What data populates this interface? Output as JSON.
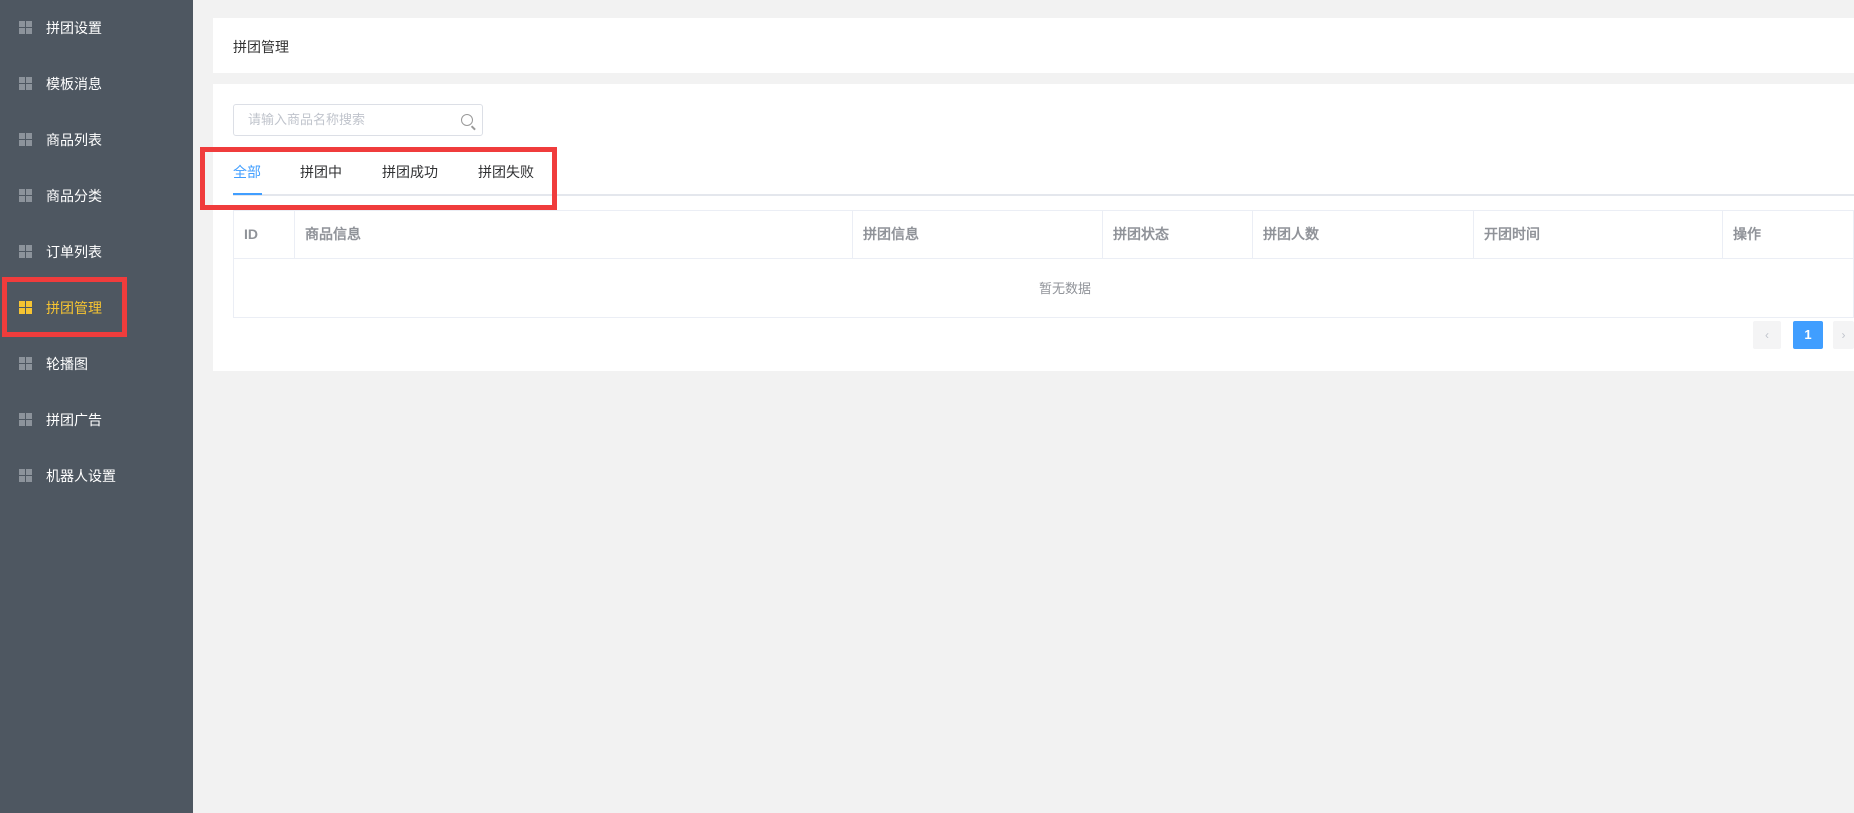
{
  "sidebar": {
    "items": [
      {
        "label": "拼团设置",
        "active": false
      },
      {
        "label": "模板消息",
        "active": false
      },
      {
        "label": "商品列表",
        "active": false
      },
      {
        "label": "商品分类",
        "active": false
      },
      {
        "label": "订单列表",
        "active": false
      },
      {
        "label": "拼团管理",
        "active": true
      },
      {
        "label": "轮播图",
        "active": false
      },
      {
        "label": "拼团广告",
        "active": false
      },
      {
        "label": "机器人设置",
        "active": false
      }
    ]
  },
  "header": {
    "title": "拼团管理"
  },
  "search": {
    "placeholder": "请输入商品名称搜索",
    "value": ""
  },
  "tabs": [
    {
      "label": "全部",
      "active": true
    },
    {
      "label": "拼团中",
      "active": false
    },
    {
      "label": "拼团成功",
      "active": false
    },
    {
      "label": "拼团失败",
      "active": false
    }
  ],
  "table": {
    "columns": [
      "ID",
      "商品信息",
      "拼团信息",
      "拼团状态",
      "拼团人数",
      "开团时间",
      "操作"
    ],
    "rows": [],
    "empty_text": "暂无数据"
  },
  "pagination": {
    "current": "1",
    "prev": "‹",
    "next": "›"
  },
  "colors": {
    "sidebar_bg": "#4e5761",
    "active_accent": "#f6c432",
    "primary": "#409eff",
    "highlight": "#f03c3c"
  }
}
